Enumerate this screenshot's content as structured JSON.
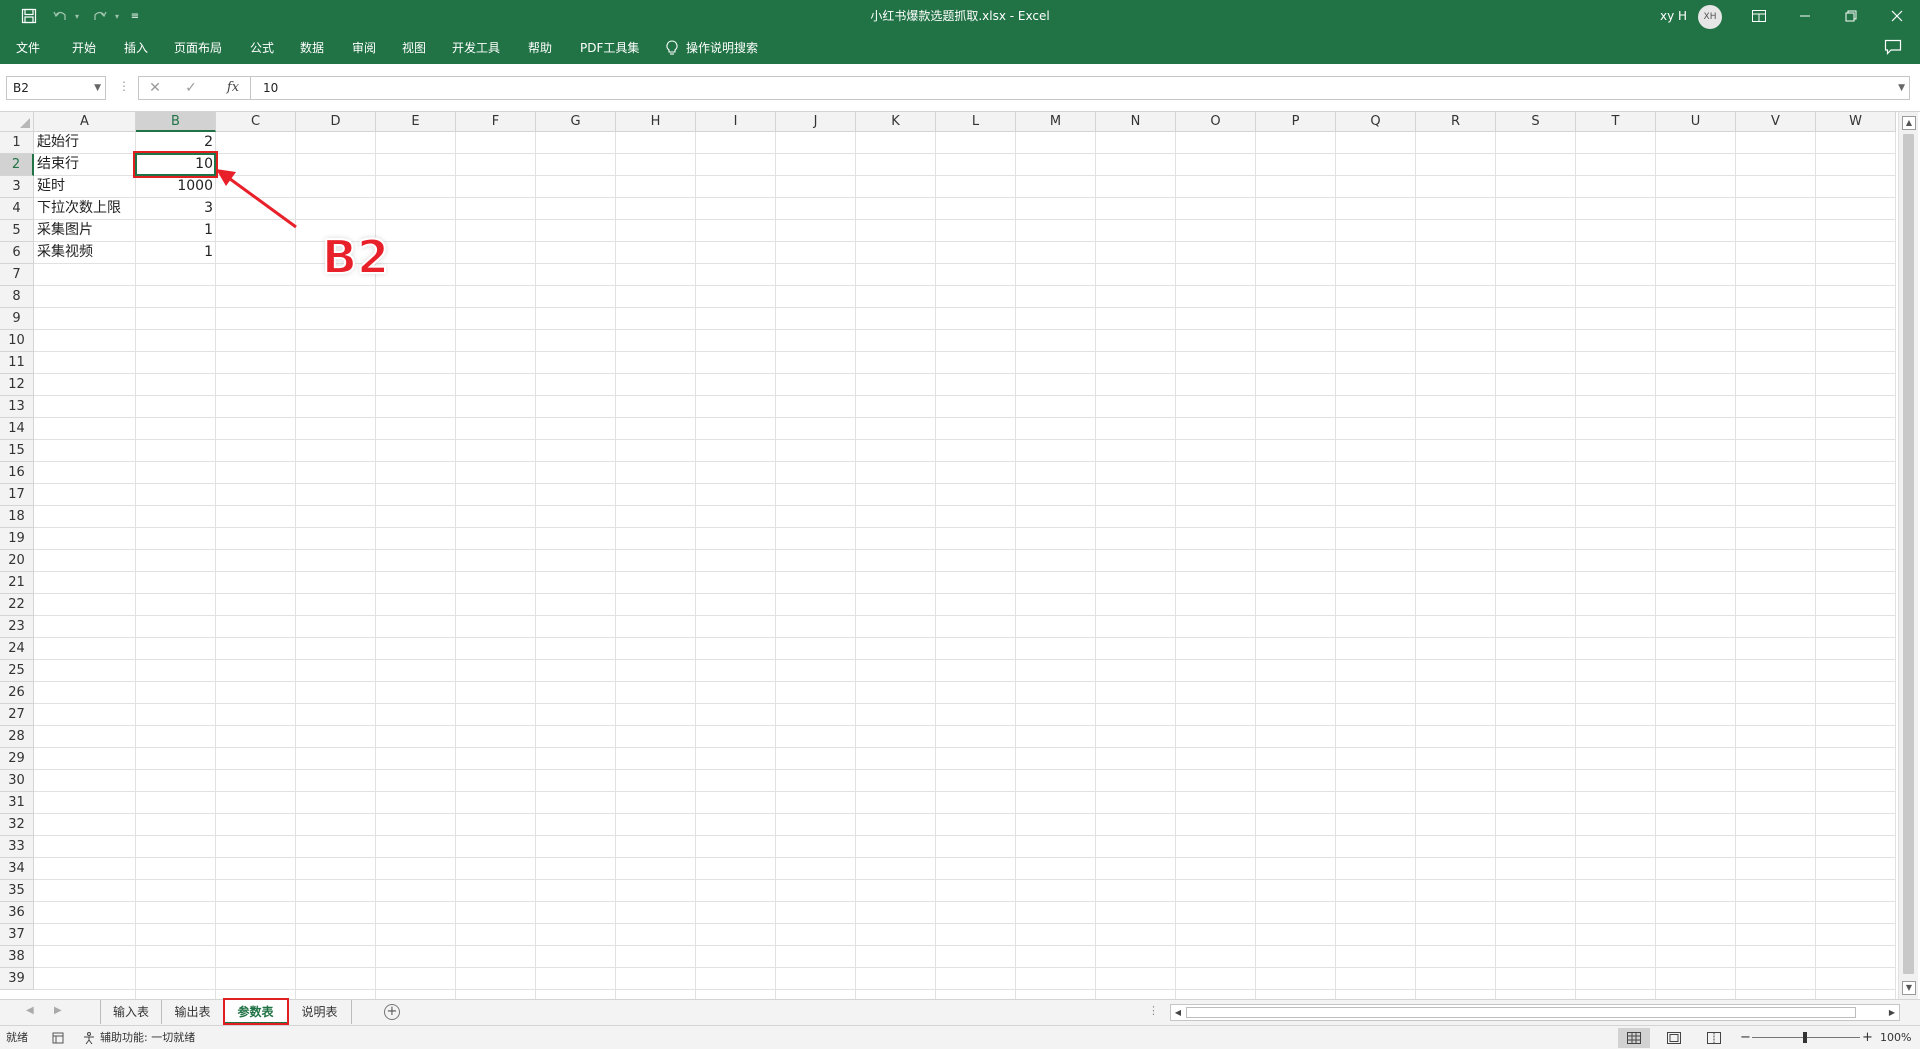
{
  "window": {
    "title": "小红书爆款选题抓取.xlsx  -  Excel",
    "user_name": "xy H",
    "user_initials": "XH"
  },
  "quick_access": {
    "icons": [
      "save-icon",
      "undo-icon",
      "redo-icon",
      "customize-icon"
    ]
  },
  "ribbon": {
    "tabs": [
      "文件",
      "开始",
      "插入",
      "页面布局",
      "公式",
      "数据",
      "审阅",
      "视图",
      "开发工具",
      "帮助",
      "PDF工具集"
    ],
    "tell_me": "操作说明搜索"
  },
  "formula_bar": {
    "name_box": "B2",
    "formula": "10",
    "fx_label": "fx"
  },
  "columns": [
    "A",
    "B",
    "C",
    "D",
    "E",
    "F",
    "G",
    "H",
    "I",
    "J",
    "K",
    "L",
    "M",
    "N",
    "O",
    "P",
    "Q",
    "R",
    "S",
    "T",
    "U",
    "V",
    "W"
  ],
  "selected_column": "B",
  "selected_row": 2,
  "row_count": 39,
  "cells": [
    {
      "ref": "A1",
      "value": "起始行"
    },
    {
      "ref": "B1",
      "value": "2"
    },
    {
      "ref": "A2",
      "value": "结束行"
    },
    {
      "ref": "B2",
      "value": "10"
    },
    {
      "ref": "A3",
      "value": "延时"
    },
    {
      "ref": "B3",
      "value": "1000"
    },
    {
      "ref": "A4",
      "value": "下拉次数上限"
    },
    {
      "ref": "B4",
      "value": "3"
    },
    {
      "ref": "A5",
      "value": "采集图片"
    },
    {
      "ref": "B5",
      "value": "1"
    },
    {
      "ref": "A6",
      "value": "采集视频"
    },
    {
      "ref": "B6",
      "value": "1"
    }
  ],
  "annotation": {
    "label": "B2",
    "color": "#e8202a"
  },
  "sheets": [
    {
      "name": "输入表",
      "active": false
    },
    {
      "name": "输出表",
      "active": false
    },
    {
      "name": "参数表",
      "active": true
    },
    {
      "name": "说明表",
      "active": false
    }
  ],
  "status_bar": {
    "ready": "就绪",
    "accessibility": "辅助功能: 一切就绪",
    "zoom": "100%"
  },
  "colors": {
    "excel_green": "#217346",
    "grid_line": "#e1e1e1",
    "annotation_red": "#e02020"
  }
}
